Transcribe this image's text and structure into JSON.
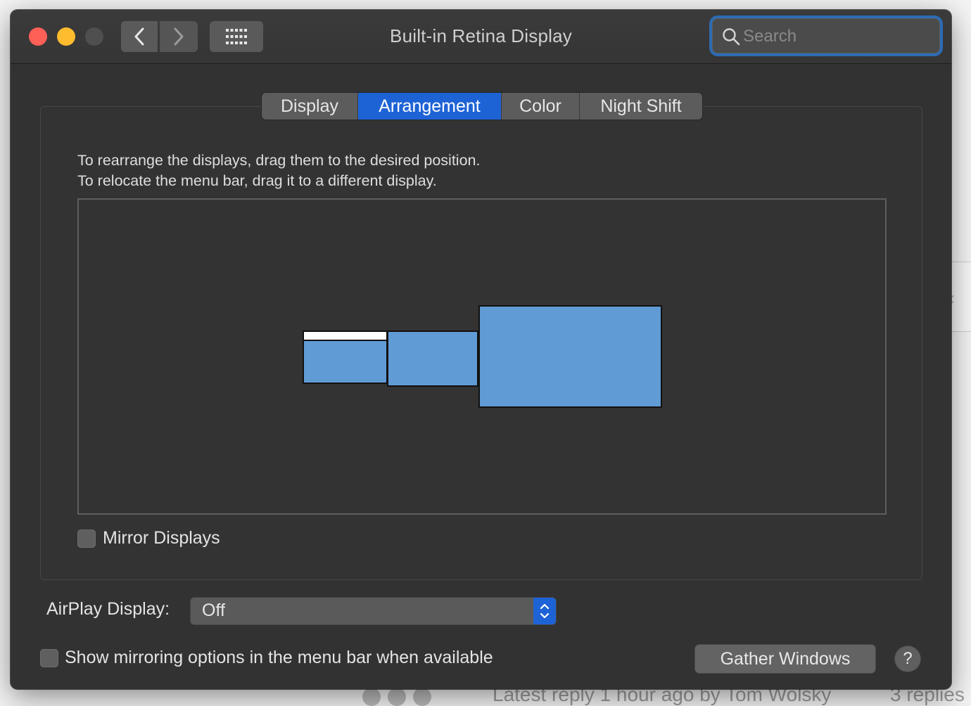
{
  "window": {
    "title": "Built-in Retina Display"
  },
  "search": {
    "placeholder": "Search"
  },
  "tabs": [
    {
      "label": "Display",
      "active": false
    },
    {
      "label": "Arrangement",
      "active": true
    },
    {
      "label": "Color",
      "active": false
    },
    {
      "label": "Night Shift",
      "active": false
    }
  ],
  "arrangement": {
    "instruction_line1": "To rearrange the displays, drag them to the desired position.",
    "instruction_line2": "To relocate the menu bar, drag it to a different display.",
    "display_color": "#619bd5"
  },
  "mirror": {
    "label": "Mirror Displays",
    "checked": false
  },
  "airplay": {
    "label": "AirPlay Display:",
    "value": "Off"
  },
  "mirroring_options": {
    "label": "Show mirroring options in the menu bar when available",
    "checked": false
  },
  "buttons": {
    "gather": "Gather Windows",
    "help": "?"
  },
  "background": {
    "footer_text": "Latest reply 1 hour ago by Tom Wolsky",
    "replies_text": "3 replies"
  },
  "colors": {
    "accent": "#1e63d6",
    "window_bg": "#323232",
    "close": "#fe5f57",
    "minimize": "#febc2e"
  }
}
